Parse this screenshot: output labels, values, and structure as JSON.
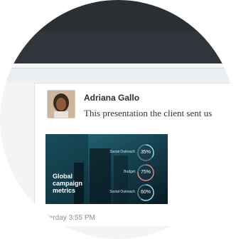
{
  "post": {
    "author": "Adriana Gallo",
    "message": "This presentation the client sent us",
    "timestamp": "terday 3:55 PM"
  },
  "attachment": {
    "title": "Global\ncampaign\nmetrics",
    "metrics": [
      {
        "name": "Social Outreach",
        "value": "35%",
        "color": "#8bd3e6"
      },
      {
        "name": "Budget",
        "value": "75%",
        "color": "#e07a7a"
      },
      {
        "name": "Social Outreach",
        "value": "60%",
        "color": "#8bd3e6"
      }
    ]
  }
}
